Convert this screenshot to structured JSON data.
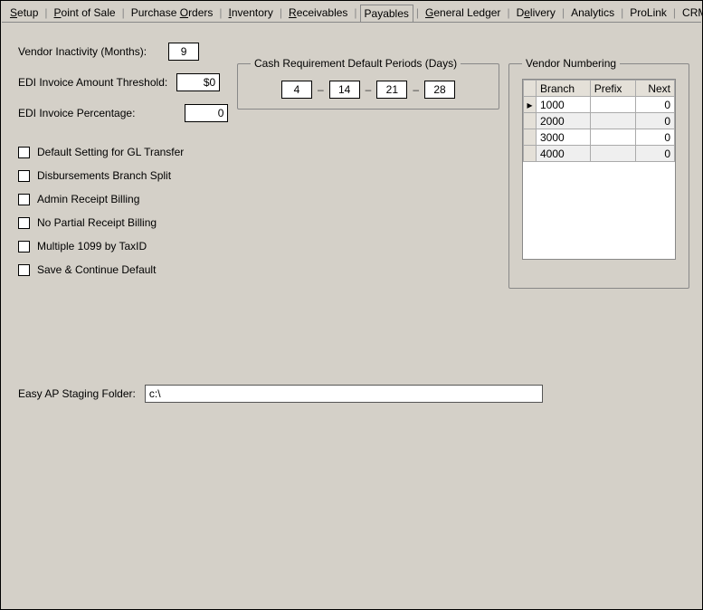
{
  "tabs": {
    "setup": "Setup",
    "pos": "Point of Sale",
    "purchase": "Purchase Orders",
    "inventory": "Inventory",
    "receivables": "Receivables",
    "payables": "Payables",
    "gl": "General Ledger",
    "delivery": "Delivery",
    "analytics": "Analytics",
    "prolink": "ProLink",
    "crm": "CRM"
  },
  "fields": {
    "vendor_inactivity_label": "Vendor Inactivity (Months):",
    "vendor_inactivity_value": "9",
    "edi_threshold_label": "EDI Invoice Amount Threshold:",
    "edi_threshold_value": "$0",
    "edi_percentage_label": "EDI Invoice Percentage:",
    "edi_percentage_value": "0"
  },
  "cash": {
    "legend": "Cash Requirement Default Periods (Days)",
    "p1": "4",
    "p2": "14",
    "p3": "21",
    "p4": "28"
  },
  "checks": {
    "gl_transfer": "Default Setting for GL Transfer",
    "branch_split": "Disbursements Branch Split",
    "admin_receipt": "Admin Receipt Billing",
    "no_partial": "No Partial Receipt Billing",
    "multi_1099": "Multiple 1099 by TaxID",
    "save_continue": "Save & Continue Default"
  },
  "vendorNumbering": {
    "legend": "Vendor Numbering",
    "headers": {
      "branch": "Branch",
      "prefix": "Prefix",
      "next": "Next"
    },
    "rows": [
      {
        "branch": "1000",
        "prefix": "",
        "next": "0"
      },
      {
        "branch": "2000",
        "prefix": "",
        "next": "0"
      },
      {
        "branch": "3000",
        "prefix": "",
        "next": "0"
      },
      {
        "branch": "4000",
        "prefix": "",
        "next": "0"
      }
    ]
  },
  "staging": {
    "label": "Easy AP Staging Folder:",
    "value": "c:\\"
  },
  "marker": "▸"
}
